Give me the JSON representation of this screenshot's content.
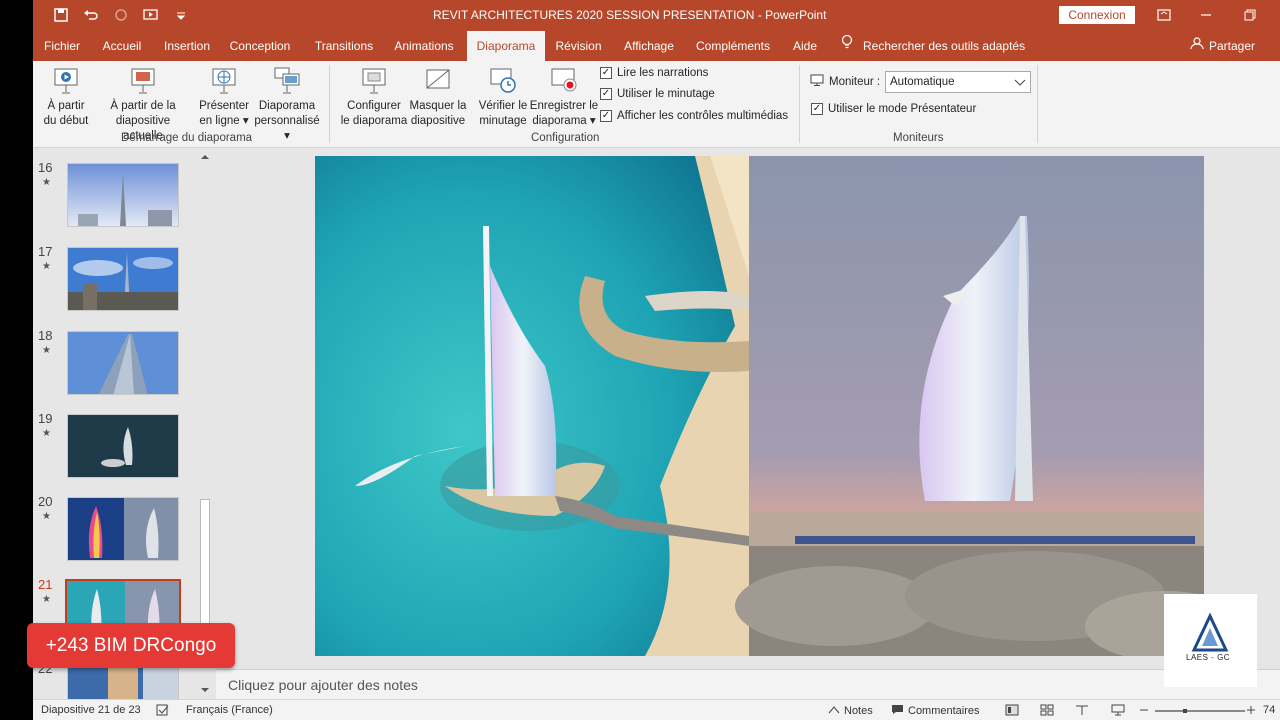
{
  "window": {
    "title": "REVIT ARCHITECTURES  2020 SESSION PRESENTATION  -  PowerPoint",
    "connexion_label": "Connexion"
  },
  "tabs": [
    {
      "label": "Fichier"
    },
    {
      "label": "Accueil"
    },
    {
      "label": "Insertion"
    },
    {
      "label": "Conception"
    },
    {
      "label": "Transitions"
    },
    {
      "label": "Animations"
    },
    {
      "label": "Diaporama",
      "active": true
    },
    {
      "label": "Révision"
    },
    {
      "label": "Affichage"
    },
    {
      "label": "Compléments"
    },
    {
      "label": "Aide"
    }
  ],
  "search_label": "Rechercher des outils adaptés",
  "share_label": "Partager",
  "ribbon": {
    "start_group": {
      "label": "Démarrage du diaporama",
      "from_start_1": "À partir",
      "from_start_2": "du début",
      "from_current_1": "À partir de la",
      "from_current_2": "diapositive actuelle",
      "present_online_1": "Présenter",
      "present_online_2": "en ligne",
      "custom_1": "Diaporama",
      "custom_2": "personnalisé"
    },
    "config_group": {
      "label": "Configuration",
      "configure_1": "Configurer",
      "configure_2": "le diaporama",
      "hide_1": "Masquer la",
      "hide_2": "diapositive",
      "rehearse_1": "Vérifier le",
      "rehearse_2": "minutage",
      "record_1": "Enregistrer le",
      "record_2": "diaporama",
      "play_narrations": "Lire les narrations",
      "use_timings": "Utiliser le minutage",
      "show_media_controls": "Afficher les contrôles multimédias"
    },
    "monitors_group": {
      "label": "Moniteurs",
      "monitor_label": "Moniteur :",
      "monitor_value": "Automatique",
      "presenter_view": "Utiliser le mode Présentateur"
    }
  },
  "slides": [
    {
      "number": "16",
      "star": "★"
    },
    {
      "number": "17",
      "star": "★"
    },
    {
      "number": "18",
      "star": "★"
    },
    {
      "number": "19",
      "star": "★"
    },
    {
      "number": "20",
      "star": "★"
    },
    {
      "number": "21",
      "star": "★",
      "selected": true
    },
    {
      "number": "22",
      "star": ""
    }
  ],
  "notes_placeholder": "Cliquez pour ajouter des notes",
  "status": {
    "slide_info": "Diapositive 21 de 23",
    "language": "Français (France)",
    "notes": "Notes",
    "comments": "Commentaires",
    "zoom": "74"
  },
  "overlay": {
    "badge": "+243 BIM DRCongo",
    "logo_text": "LAES - GC"
  },
  "colors": {
    "accent": "#b7472a",
    "badge": "#e53935"
  }
}
